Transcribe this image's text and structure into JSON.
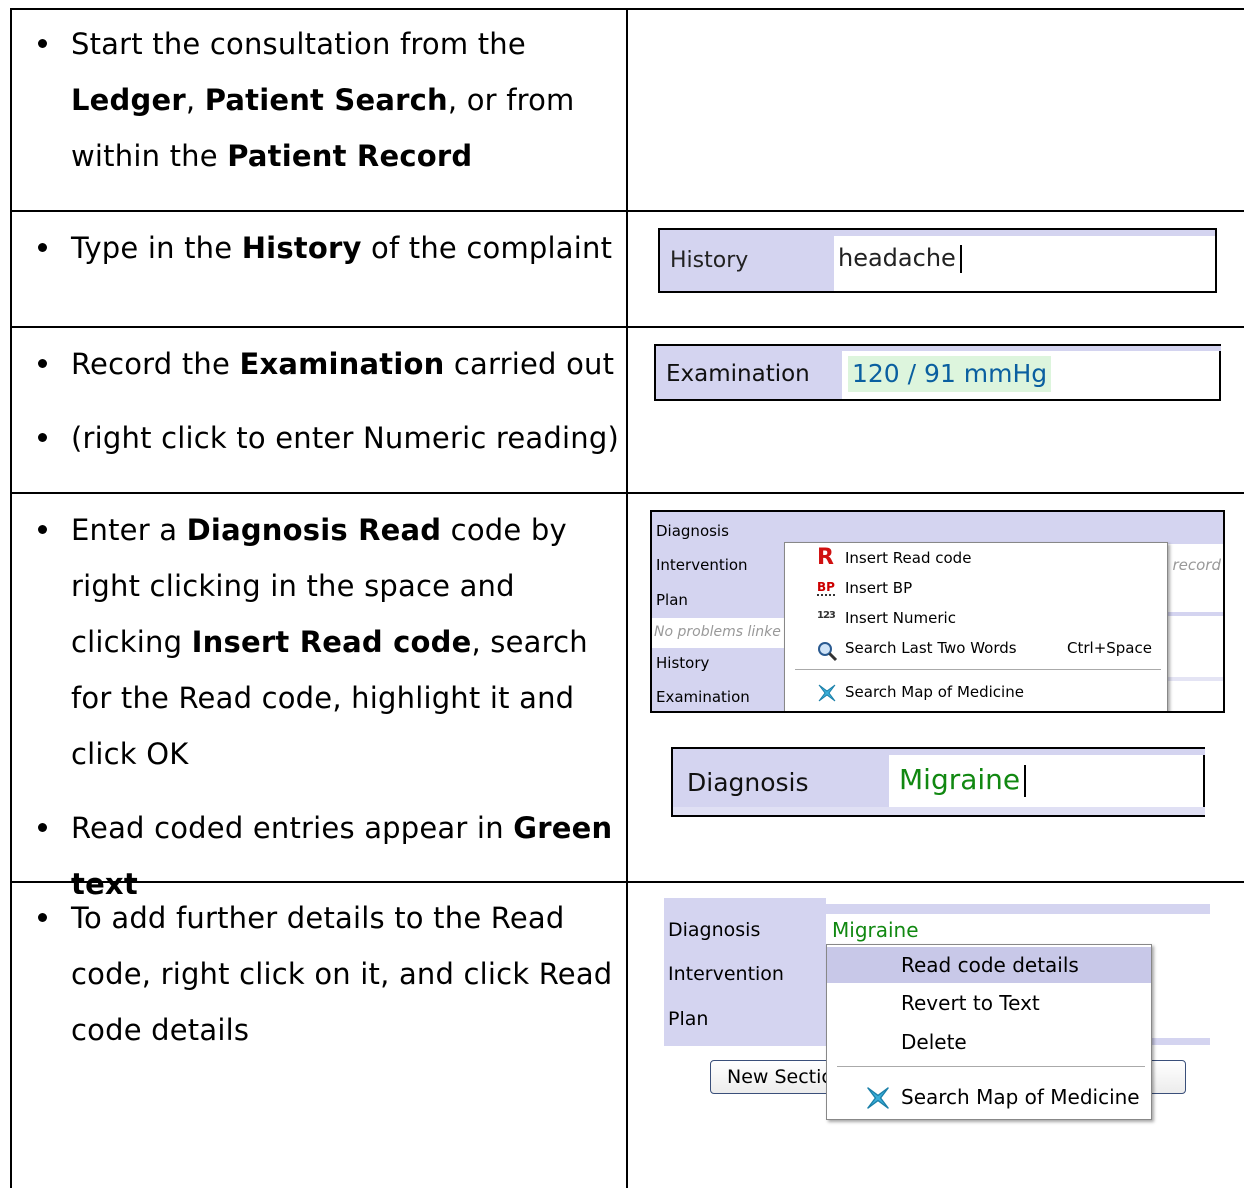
{
  "rows": [
    {
      "items": [
        [
          {
            "t": "Start the consultation from the "
          },
          {
            "b": "Ledger"
          },
          {
            "t": ", "
          },
          {
            "b": "Patient Search"
          },
          {
            "t": ", or from within the "
          },
          {
            "b": "Patient Record"
          }
        ]
      ]
    },
    {
      "items": [
        [
          {
            "t": "Type in the "
          },
          {
            "b": "History"
          },
          {
            "t": " of the complaint"
          }
        ]
      ],
      "shot": {
        "label": "History",
        "value": "headache"
      }
    },
    {
      "items": [
        [
          {
            "t": "Record the "
          },
          {
            "b": "Examination"
          },
          {
            "t": " carried out"
          }
        ],
        [
          {
            "t": "(right click to enter Numeric reading)"
          }
        ]
      ],
      "shot": {
        "label": "Examination",
        "value": "120 / 91 mmHg"
      }
    },
    {
      "items": [
        [
          {
            "t": "Enter a "
          },
          {
            "b": "Diagnosis Read"
          },
          {
            "t": " code by right clicking in the space and clicking "
          },
          {
            "b": "Insert Read code"
          },
          {
            "t": ", search for the Read code, highlight it and click OK"
          }
        ],
        [
          {
            "t": "Read coded entries appear in "
          },
          {
            "b": "Green text"
          }
        ]
      ],
      "shot_menu": {
        "side_labels": [
          "Diagnosis",
          "Intervention",
          "Plan",
          "No problems linke",
          "History",
          "Examination"
        ],
        "faded_right": "s record",
        "menu_items": [
          {
            "icon": "read-code-icon",
            "glyph": "R",
            "label": "Insert Read code",
            "shortcut": ""
          },
          {
            "icon": "bp-icon",
            "glyph": "BP",
            "label": "Insert BP",
            "shortcut": ""
          },
          {
            "icon": "numeric-icon",
            "glyph": "123",
            "label": "Insert Numeric",
            "shortcut": ""
          },
          {
            "icon": "magnifier-icon",
            "glyph": "",
            "label": "Search Last Two Words",
            "shortcut": "Ctrl+Space"
          },
          {
            "icon": "map-of-medicine-icon",
            "glyph": "",
            "label": "Search Map of Medicine",
            "shortcut": ""
          }
        ]
      },
      "shot_diag": {
        "label": "Diagnosis",
        "value": "Migraine"
      }
    },
    {
      "items": [
        [
          {
            "t": "To add further details to the Read code, right click on it, and click Read code details"
          }
        ]
      ],
      "shot_details": {
        "side_labels": [
          "Diagnosis",
          "Intervention",
          "Plan"
        ],
        "value": "Migraine",
        "button_label": "New Sectic",
        "menu_items": [
          "Read code details",
          "Revert to Text",
          "Delete",
          "Search Map of Medicine"
        ]
      }
    }
  ],
  "colors": {
    "lavender": "#d4d4f0",
    "green_text": "#118811",
    "highlight": "#c8c8e8",
    "numeric_bg": "#ddf5dd"
  }
}
